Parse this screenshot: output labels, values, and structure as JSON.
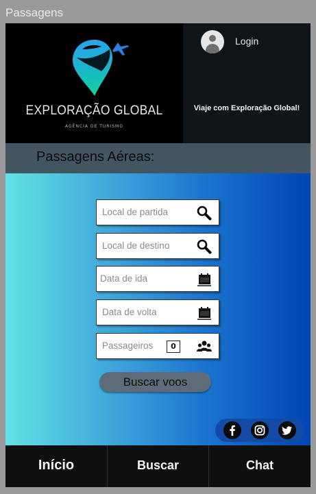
{
  "window": {
    "title": "Passagens"
  },
  "header": {
    "brand_name": "EXPLORAÇÃO GLOBAL",
    "brand_subtitle": "AGÊNCIA DE TURISMO",
    "login_label": "Login",
    "tagline": "Viaje com Exploração Global!"
  },
  "section": {
    "title": "Passagens Aéreas:"
  },
  "form": {
    "origin_placeholder": "Local de partida",
    "destination_placeholder": "Local de destino",
    "departure_placeholder": "Data de ida",
    "return_placeholder": "Data de volta",
    "passengers_label": "Passageiros",
    "passengers_value": "0",
    "search_button": "Buscar voos"
  },
  "social": {
    "icons": [
      "facebook-icon",
      "instagram-icon",
      "twitter-icon"
    ]
  },
  "footer": {
    "items": [
      "Início",
      "Buscar",
      "Chat"
    ]
  },
  "colors": {
    "gradient_start": "#63e2e6",
    "gradient_end": "#0045b4",
    "section_bar": "#435561",
    "button": "#5e6b78",
    "dark": "#0c0f12"
  }
}
